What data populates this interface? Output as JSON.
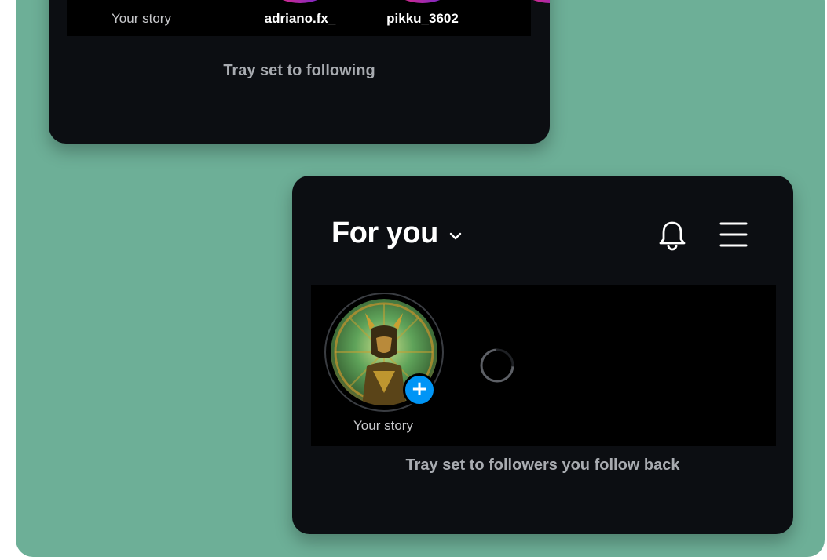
{
  "top_card": {
    "stories": [
      {
        "username": "Your story"
      },
      {
        "username": "adriano.fx_"
      },
      {
        "username": "pikku_3602"
      }
    ],
    "caption": "Tray set to following"
  },
  "bottom_card": {
    "header": {
      "title": "For you",
      "icons": [
        "chevron-down-icon",
        "bell-icon",
        "hamburger-menu-icon"
      ]
    },
    "stories": [
      {
        "username": "Your story"
      }
    ],
    "loading_indicator": "spinner",
    "caption": "Tray set to followers you follow back"
  },
  "colors": {
    "background": "#6daf97",
    "card": "#0c0e12",
    "tray": "#000000",
    "add_badge": "#0095f6"
  }
}
